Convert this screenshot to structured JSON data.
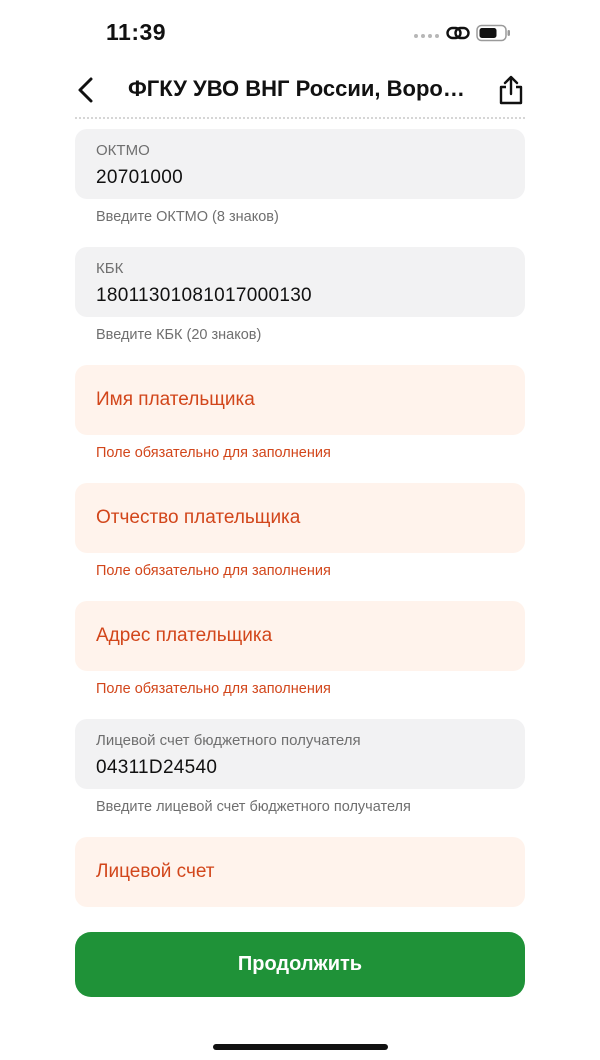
{
  "status_bar": {
    "time": "11:39"
  },
  "nav": {
    "title": "ФГКУ УВО ВНГ России, Воронежская область",
    "back_icon": "chevron-left-icon",
    "share_icon": "share-icon"
  },
  "fields": [
    {
      "label": "ОКТМО",
      "value": "20701000",
      "helper": "Введите ОКТМО (8 знаков)",
      "state": "filled"
    },
    {
      "label": "КБК",
      "value": "18011301081017000130",
      "helper": "Введите КБК (20 знаков)",
      "state": "filled"
    },
    {
      "placeholder": "Имя плательщика",
      "helper": "Поле обязательно для заполнения",
      "state": "error"
    },
    {
      "placeholder": "Отчество плательщика",
      "helper": "Поле обязательно для заполнения",
      "state": "error"
    },
    {
      "placeholder": "Адрес плательщика",
      "helper": "Поле обязательно для заполнения",
      "state": "error"
    },
    {
      "label": "Лицевой счет бюджетного получателя",
      "value": "04311D24540",
      "helper": "Введите лицевой счет бюджетного получателя",
      "state": "filled"
    },
    {
      "placeholder": "Лицевой счет",
      "state": "error"
    }
  ],
  "continue_button": {
    "label": "Продолжить"
  },
  "colors": {
    "accent_green": "#1f9238",
    "error_text": "#d2461b",
    "error_background": "#fff3ec",
    "field_background": "#f2f2f3"
  }
}
